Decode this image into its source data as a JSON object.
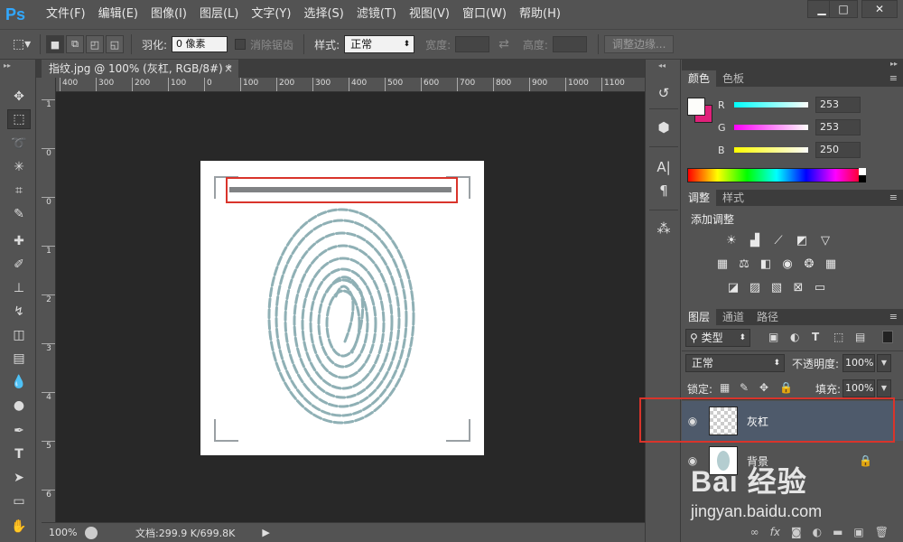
{
  "app": {
    "logo": "Ps"
  },
  "menu": [
    "文件(F)",
    "编辑(E)",
    "图像(I)",
    "图层(L)",
    "文字(Y)",
    "选择(S)",
    "滤镜(T)",
    "视图(V)",
    "窗口(W)",
    "帮助(H)"
  ],
  "options": {
    "feather_label": "羽化:",
    "feather_value": "0 像素",
    "antialias_label": "消除锯齿",
    "style_label": "样式:",
    "style_value": "正常",
    "width_label": "宽度:",
    "height_label": "高度:",
    "refine_edge_label": "调整边缘..."
  },
  "document_tab": {
    "title": "指纹.jpg @ 100% (灰杠, RGB/8#) *",
    "close": "×"
  },
  "ruler": {
    "top_ticks": [
      "400",
      "300",
      "200",
      "100",
      "0",
      "100",
      "200",
      "300",
      "400",
      "500",
      "600",
      "700",
      "800",
      "900",
      "1000",
      "1100"
    ],
    "left_ticks": [
      "1",
      "0",
      "0",
      "1",
      "2",
      "3",
      "4",
      "5",
      "6"
    ]
  },
  "status": {
    "zoom": "100%",
    "doc_info": "文档:299.9 K/699.8K"
  },
  "color_panel": {
    "tabs": [
      "颜色",
      "色板"
    ],
    "r_label": "R",
    "g_label": "G",
    "b_label": "B",
    "r_value": "253",
    "g_value": "253",
    "b_value": "250",
    "fg_color": "#fdfdfa",
    "bg_color": "#e0207a"
  },
  "adjust_panel": {
    "tabs": [
      "调整",
      "样式"
    ],
    "title": "添加调整"
  },
  "layers_panel": {
    "tabs": [
      "图层",
      "通道",
      "路径"
    ],
    "filter_label": "类型",
    "blend_mode": "正常",
    "opacity_label": "不透明度:",
    "opacity_value": "100%",
    "lock_label": "锁定:",
    "fill_label": "填充:",
    "fill_value": "100%",
    "layers": [
      {
        "name": "灰杠"
      },
      {
        "name": "背景"
      }
    ]
  },
  "watermark": {
    "brand": "Bai 经验",
    "url": "jingyan.baidu.com"
  },
  "colors": {
    "highlight": "#d9342b",
    "bar": "#808284",
    "selected_layer": "#4e5a6b"
  }
}
